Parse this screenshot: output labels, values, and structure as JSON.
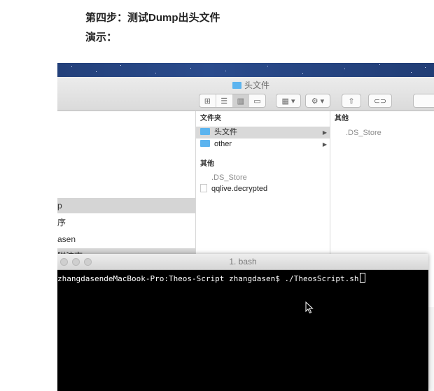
{
  "article": {
    "step_heading": "第四步：测试Dump出头文件",
    "demo_label": "演示："
  },
  "finder": {
    "window_title": "头文件",
    "columns": [
      {
        "header": "",
        "rows": [
          "p",
          "序",
          "asen",
          "附注市"
        ]
      },
      {
        "header": "文件夹",
        "folders": [
          {
            "name": "头文件",
            "selected": true
          },
          {
            "name": "other",
            "selected": false
          }
        ],
        "others_header": "其他",
        "files": [
          ".DS_Store",
          "qqlive.decrypted"
        ]
      },
      {
        "header": "其他",
        "files": [
          ".DS_Store"
        ]
      }
    ],
    "colors": {
      "folder": "#5cb4ef",
      "selection": "#d9d9d9"
    }
  },
  "terminal": {
    "title": "1. bash",
    "prompt_line": "zhangdasendeMacBook-Pro:Theos-Script zhangdasen$ ./TheosScript.sh"
  },
  "icons": [
    "folder-icon",
    "document-icon",
    "grid-view-icon",
    "list-view-icon",
    "column-view-icon",
    "coverflow-view-icon",
    "arrange-icon",
    "gear-icon",
    "share-icon",
    "tag-icon",
    "mouse-pointer-icon"
  ]
}
